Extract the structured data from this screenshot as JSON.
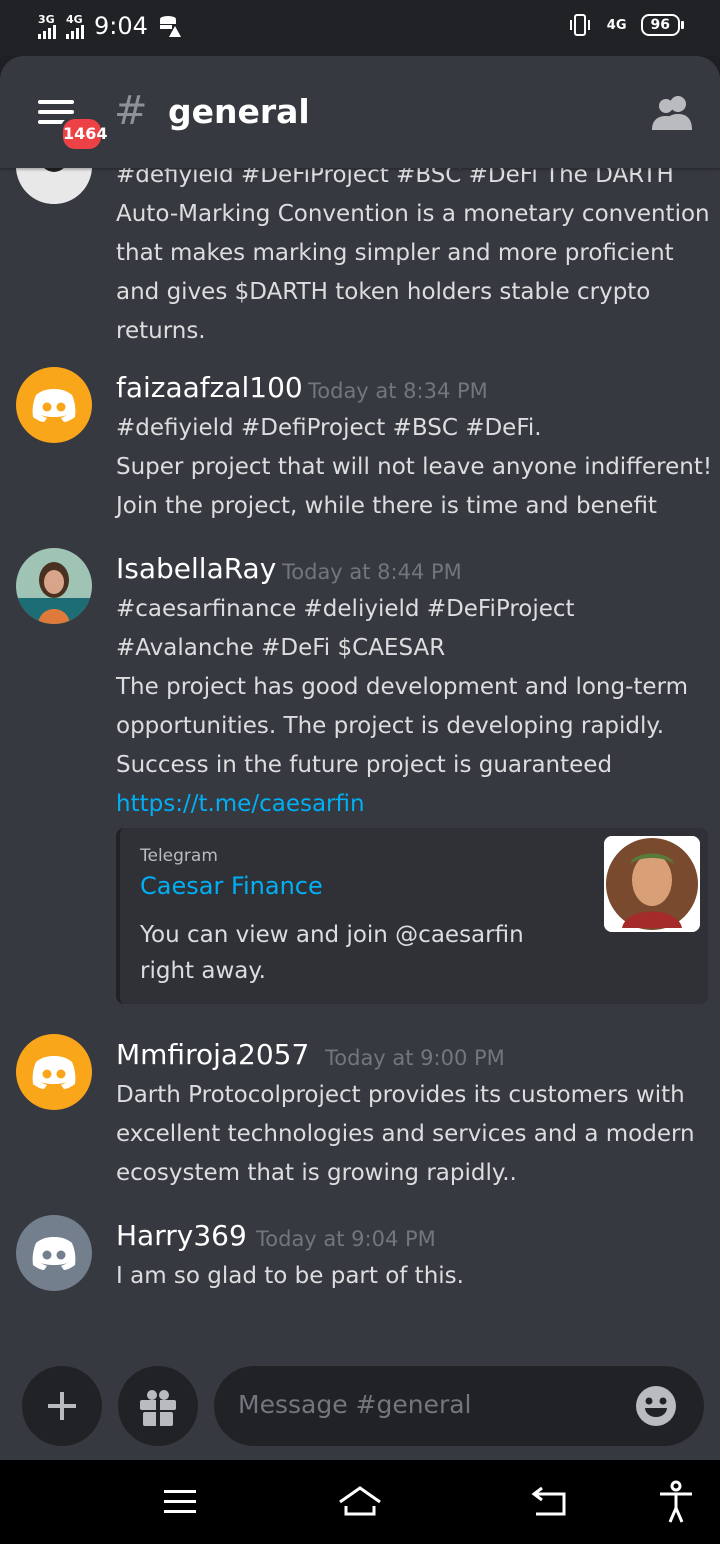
{
  "status": {
    "net1": "3G",
    "net2": "4G",
    "time": "9:04",
    "net_right": "4G",
    "battery": "96"
  },
  "header": {
    "unread_badge": "1464",
    "hash": "#",
    "channel": "general"
  },
  "messages": [
    {
      "lines": [
        "#defiyield #DeFiProject #BSC #DeFi The DARTH",
        "Auto-Marking Convention is a monetary convention",
        "that makes marking simpler and more proficient",
        "and gives $DARTH token holders stable crypto",
        "returns."
      ]
    },
    {
      "author": "faizaafzal100",
      "time": "Today at 8:34 PM",
      "lines": [
        "#defiyield #DefiProject #BSC #DeFi.",
        "Super project that will not leave anyone indifferent!",
        "Join the project, while there is time and benefit"
      ]
    },
    {
      "author": "IsabellaRay",
      "time": "Today at 8:44 PM",
      "lines": [
        "#caesarfinance #deliyield #DeFiProject",
        "#Avalanche #DeFi $CAESAR",
        "The project has good development and long-term",
        "opportunities. The project is developing rapidly.",
        "Success in the future project is guaranteed"
      ],
      "link": "https://t.me/caesarfin",
      "embed": {
        "provider": "Telegram",
        "title": "Caesar Finance",
        "desc_lines": [
          "You can view and join @caesarfin",
          "right away."
        ]
      }
    },
    {
      "author": "Mmfiroja2057",
      "time": "Today at 9:00 PM",
      "lines": [
        "Darth Protocolproject provides its customers with",
        "excellent technologies and services and a modern",
        "ecosystem that is growing rapidly.."
      ]
    },
    {
      "author": "Harry369",
      "time": "Today at 9:04 PM",
      "lines": [
        "I am so glad to be part of this."
      ]
    }
  ],
  "composer": {
    "placeholder": "Message #general"
  },
  "colors": {
    "background": "#36393f",
    "link": "#00aff4",
    "avatar_yellow": "#faa61a",
    "avatar_gray": "#747f8d",
    "badge": "#ed4245"
  }
}
